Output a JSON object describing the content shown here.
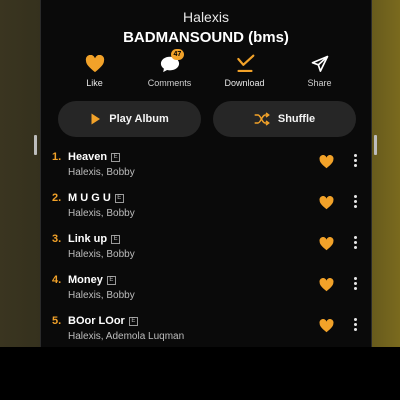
{
  "header": {
    "artist": "Halexis",
    "album": "BADMANSOUND (bms)"
  },
  "actions": {
    "like": {
      "label": "Like",
      "icon": "heart-icon"
    },
    "comments": {
      "label": "Comments",
      "icon": "comment-icon",
      "count": "47"
    },
    "download": {
      "label": "Download",
      "icon": "download-icon"
    },
    "share": {
      "label": "Share",
      "icon": "share-icon"
    }
  },
  "buttons": {
    "play": "Play Album",
    "shuffle": "Shuffle"
  },
  "tracks": [
    {
      "number": "1.",
      "title": "Heaven",
      "explicit": "E",
      "artists": "Halexis, Bobby"
    },
    {
      "number": "2.",
      "title": "M U G U",
      "explicit": "E",
      "artists": "Halexis, Bobby"
    },
    {
      "number": "3.",
      "title": "Link up",
      "explicit": "E",
      "artists": "Halexis, Bobby"
    },
    {
      "number": "4.",
      "title": "Money",
      "explicit": "E",
      "artists": "Halexis, Bobby"
    },
    {
      "number": "5.",
      "title": "BOor LOor",
      "explicit": "E",
      "artists": "Halexis, Ademola Luqman"
    }
  ],
  "colors": {
    "accent": "#f2a229",
    "background": "#0a0a0a",
    "button": "#262626"
  }
}
